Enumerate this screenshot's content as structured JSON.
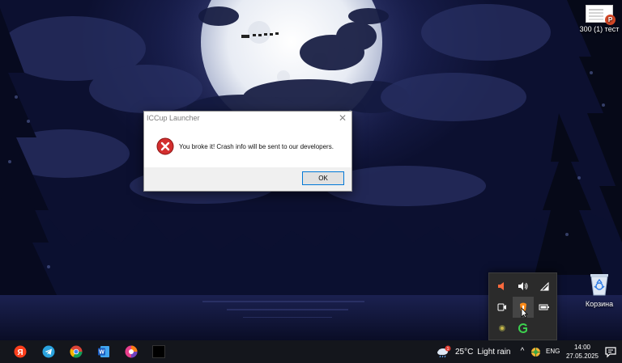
{
  "desktop": {
    "file_label": "300 (1) тест",
    "file_badge": "P",
    "recycle_bin_label": "Корзина"
  },
  "dialog": {
    "title": "ICCup Launcher",
    "close_glyph": "✕",
    "message": "You broke it! Crash info will be sent to our developers.",
    "ok_label": "OK"
  },
  "tray_flyout": {
    "items": [
      "volume-off-icon",
      "speaker-icon",
      "wifi-icon",
      "camera-icon",
      "iccup-icon",
      "battery-icon",
      "cpu-icon",
      "green-app-icon"
    ]
  },
  "taskbar": {
    "apps": [
      "yandex-icon",
      "telegram-icon",
      "chrome-icon",
      "word-icon",
      "colorful-app-icon",
      "black-app-icon"
    ],
    "yandex_letter": "Я",
    "word_letter": "W",
    "weather_temp": "25°C",
    "weather_desc": "Light rain",
    "weather_alert": "1",
    "tray_chevron": "^",
    "language": "ENG",
    "time": "14:00",
    "date": "27.05.2025"
  },
  "colors": {
    "accent": "#0078d7",
    "error_red": "#d32f2f",
    "taskbar_bg": "#14161c",
    "flyout_bg": "#2b2b2b"
  }
}
